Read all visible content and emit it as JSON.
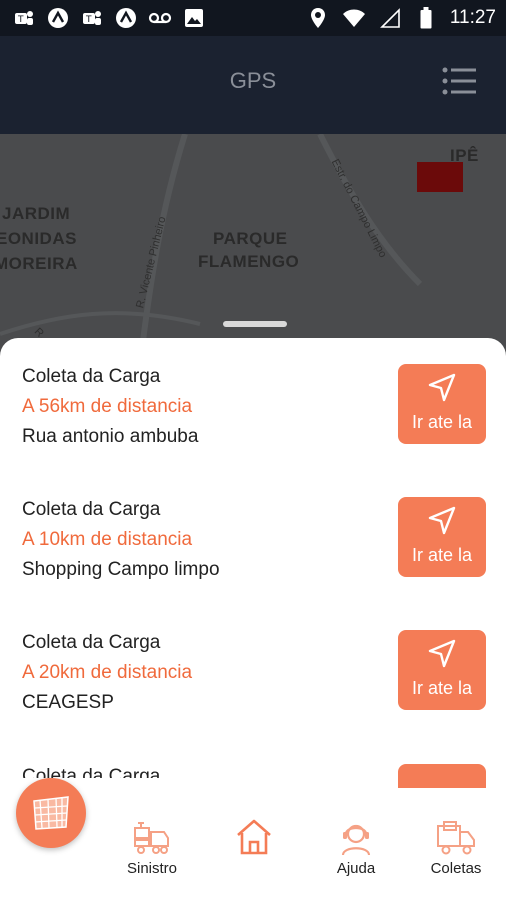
{
  "status_bar": {
    "time": "11:27"
  },
  "app_bar": {
    "title": "GPS"
  },
  "map": {
    "labels": [
      "JARDIM",
      "EONIDAS",
      "MOREIRA",
      "PARQUE",
      "FLAMENGO",
      "IPÊ"
    ],
    "streets": [
      "R. Vicente Pinheiro",
      "Estr. do Campo Limpo",
      "R. C"
    ]
  },
  "collections": [
    {
      "title": "Coleta da Carga",
      "distance": "A 56km de distancia",
      "address": "Rua antonio ambuba",
      "button": "Ir ate la"
    },
    {
      "title": "Coleta da Carga",
      "distance": "A 10km de distancia",
      "address": "Shopping Campo limpo",
      "button": "Ir ate la"
    },
    {
      "title": "Coleta da Carga",
      "distance": "A 20km de distancia",
      "address": "CEAGESP",
      "button": "Ir ate la"
    }
  ],
  "peek_item": {
    "title": "Coleta da Carga"
  },
  "bottom_nav": {
    "sinistro": "Sinistro",
    "ajuda": "Ajuda",
    "coletas": "Coletas"
  },
  "colors": {
    "accent": "#f47c56",
    "distance_text": "#f06a3c",
    "app_bar": "#1b2230",
    "map": "#4a4b4d"
  }
}
